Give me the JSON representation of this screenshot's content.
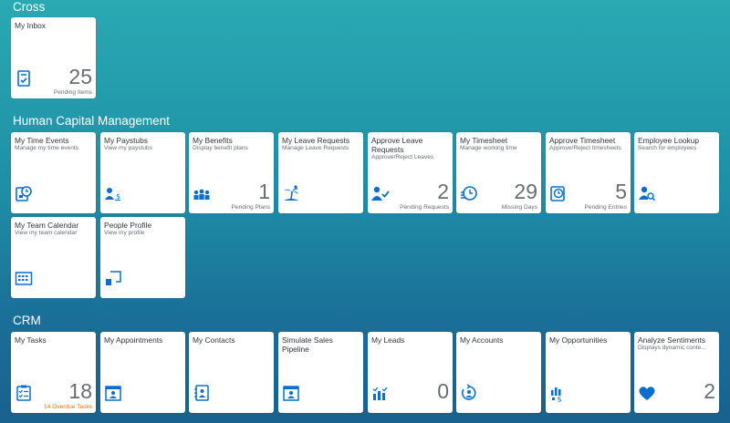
{
  "colors": {
    "icon": "#0a6ed1",
    "warning": "#e9730c",
    "number": "#6a6d70"
  },
  "groups": [
    {
      "title": "Cross",
      "tiles": [
        {
          "title": "My Inbox",
          "subtitle": "",
          "icon": "inbox-icon",
          "number": "25",
          "footer": "Pending Items"
        }
      ]
    },
    {
      "title": "Human Capital Management",
      "tiles": [
        {
          "title": "My Time Events",
          "subtitle": "Manage my time events",
          "icon": "time-events-icon",
          "number": "",
          "footer": ""
        },
        {
          "title": "My Paystubs",
          "subtitle": "View my paystubs",
          "icon": "paystubs-icon",
          "number": "",
          "footer": ""
        },
        {
          "title": "My Benefits",
          "subtitle": "Display benefit plans",
          "icon": "benefits-icon",
          "number": "1",
          "footer": "Pending Plans"
        },
        {
          "title": "My Leave Requests",
          "subtitle": "Manage Leave Requests",
          "icon": "leave-icon",
          "number": "",
          "footer": ""
        },
        {
          "title": "Approve Leave Requests",
          "subtitle": "Approve/Reject Leaves",
          "icon": "approve-person-icon",
          "number": "2",
          "footer": "Pending Requests"
        },
        {
          "title": "My Timesheet",
          "subtitle": "Manage working time",
          "icon": "timesheet-icon",
          "number": "29",
          "footer": "Missing Days"
        },
        {
          "title": "Approve Timesheet",
          "subtitle": "Approve/Reject timesheets",
          "icon": "approve-timesheet-icon",
          "number": "5",
          "footer": "Pending Entries"
        },
        {
          "title": "Employee Lookup",
          "subtitle": "Search for employees",
          "icon": "employee-lookup-icon",
          "number": "",
          "footer": ""
        },
        {
          "title": "My Team Calendar",
          "subtitle": "View my team calendar",
          "icon": "team-calendar-icon",
          "number": "",
          "footer": ""
        },
        {
          "title": "People Profile",
          "subtitle": "View my profile",
          "icon": "people-profile-icon",
          "number": "",
          "footer": ""
        }
      ]
    },
    {
      "title": "CRM",
      "tiles": [
        {
          "title": "My Tasks",
          "subtitle": "",
          "icon": "tasks-icon",
          "number": "18",
          "footer": "14 Overdue Tasks",
          "footer_warning": true
        },
        {
          "title": "My Appointments",
          "subtitle": "",
          "icon": "appointments-icon",
          "number": "",
          "footer": ""
        },
        {
          "title": "My Contacts",
          "subtitle": "",
          "icon": "contacts-icon",
          "number": "",
          "footer": ""
        },
        {
          "title": "Simulate Sales Pipeline",
          "subtitle": "",
          "icon": "pipeline-icon",
          "number": "",
          "footer": ""
        },
        {
          "title": "My Leads",
          "subtitle": "",
          "icon": "leads-icon",
          "number": "0",
          "footer": ""
        },
        {
          "title": "My Accounts",
          "subtitle": "",
          "icon": "accounts-icon",
          "number": "",
          "footer": ""
        },
        {
          "title": "My Opportunities",
          "subtitle": "",
          "icon": "opportunities-icon",
          "number": "",
          "footer": ""
        },
        {
          "title": "Analyze Sentiments",
          "subtitle": "Displays dynamic conte...",
          "icon": "heart-icon",
          "number": "2",
          "footer": ""
        }
      ]
    }
  ]
}
